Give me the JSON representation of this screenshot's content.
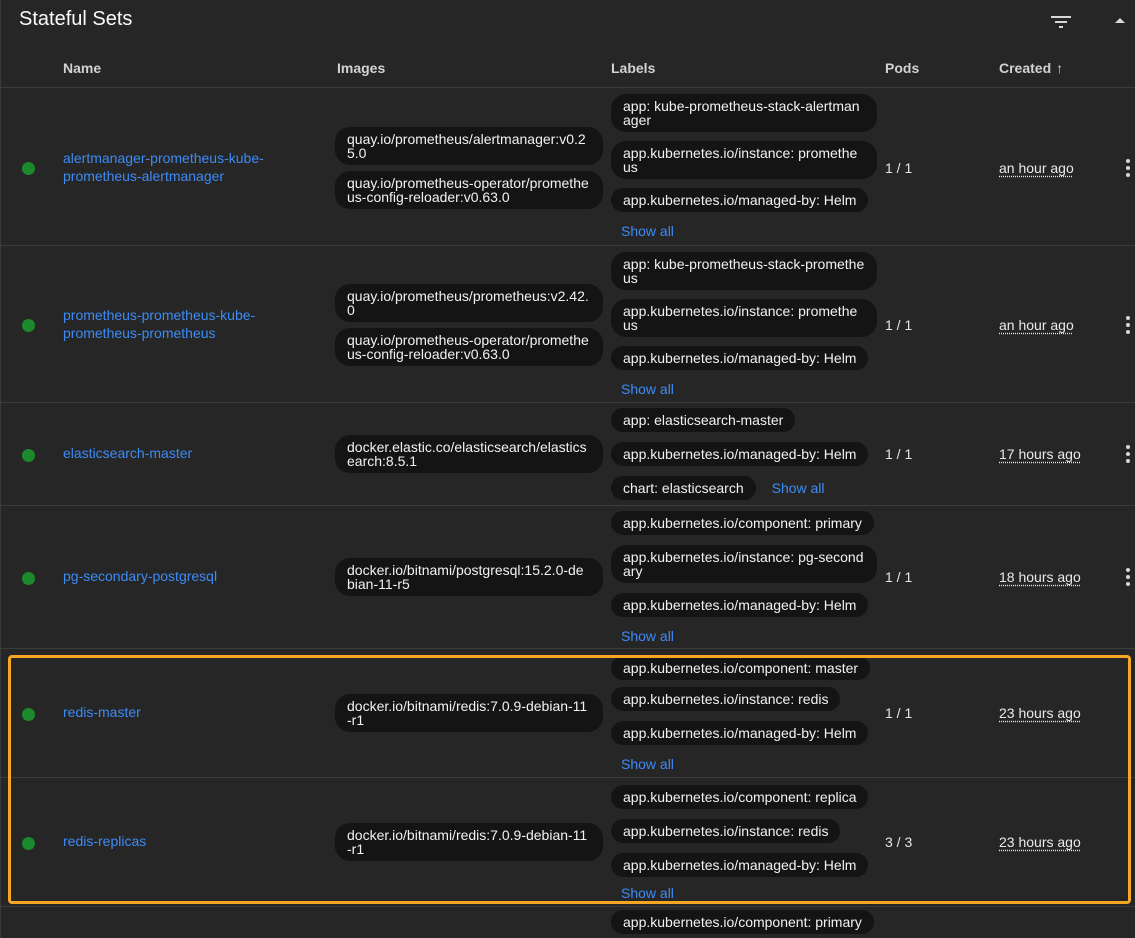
{
  "panel": {
    "title": "Stateful Sets",
    "filter_icon": "filter-icon",
    "collapse_icon": "chevron-up-icon"
  },
  "columns": {
    "name": "Name",
    "images": "Images",
    "labels": "Labels",
    "pods": "Pods",
    "created": "Created",
    "sort_arrow": "↑"
  },
  "rows": [
    {
      "name": "alertmanager-prometheus-kube-prometheus-alertmanager",
      "images": [
        "quay.io/prometheus/alertmanager:v0.25.0",
        "quay.io/prometheus-operator/prometheus-config-reloader:v0.63.0"
      ],
      "labels": [
        "app: kube-prometheus-stack-alertmanager",
        "app.kubernetes.io/instance: prometheus",
        "app.kubernetes.io/managed-by: Helm"
      ],
      "show_all": "Show all",
      "pods": "1 / 1",
      "created": "an hour ago",
      "status": "ready"
    },
    {
      "name": "prometheus-prometheus-kube-prometheus-prometheus",
      "images": [
        "quay.io/prometheus/prometheus:v2.42.0",
        "quay.io/prometheus-operator/prometheus-config-reloader:v0.63.0"
      ],
      "labels": [
        "app: kube-prometheus-stack-prometheus",
        "app.kubernetes.io/instance: prometheus",
        "app.kubernetes.io/managed-by: Helm"
      ],
      "show_all": "Show all",
      "pods": "1 / 1",
      "created": "an hour ago",
      "status": "ready"
    },
    {
      "name": "elasticsearch-master",
      "images": [
        "docker.elastic.co/elasticsearch/elasticsearch:8.5.1"
      ],
      "labels": [
        "app: elasticsearch-master",
        "app.kubernetes.io/managed-by: Helm",
        "chart: elasticsearch"
      ],
      "show_all": "Show all",
      "pods": "1 / 1",
      "created": "17 hours ago",
      "status": "ready"
    },
    {
      "name": "pg-secondary-postgresql",
      "images": [
        "docker.io/bitnami/postgresql:15.2.0-debian-11-r5"
      ],
      "labels": [
        "app.kubernetes.io/component: primary",
        "app.kubernetes.io/instance: pg-secondary",
        "app.kubernetes.io/managed-by: Helm"
      ],
      "show_all": "Show all",
      "pods": "1 / 1",
      "created": "18 hours ago",
      "status": "ready"
    },
    {
      "name": "redis-master",
      "images": [
        "docker.io/bitnami/redis:7.0.9-debian-11-r1"
      ],
      "labels": [
        "app.kubernetes.io/component: master",
        "app.kubernetes.io/instance: redis",
        "app.kubernetes.io/managed-by: Helm"
      ],
      "show_all": "Show all",
      "pods": "1 / 1",
      "created": "23 hours ago",
      "status": "ready"
    },
    {
      "name": "redis-replicas",
      "images": [
        "docker.io/bitnami/redis:7.0.9-debian-11-r1"
      ],
      "labels": [
        "app.kubernetes.io/component: replica",
        "app.kubernetes.io/instance: redis",
        "app.kubernetes.io/managed-by: Helm"
      ],
      "show_all": "Show all",
      "pods": "3 / 3",
      "created": "23 hours ago",
      "status": "ready"
    },
    {
      "labels": [
        "app.kubernetes.io/component: primary"
      ]
    }
  ],
  "colors": {
    "link": "#3d8bf5",
    "status_ready": "#1b8a2c",
    "highlight": "#f5a623",
    "chip_bg": "#141414"
  }
}
